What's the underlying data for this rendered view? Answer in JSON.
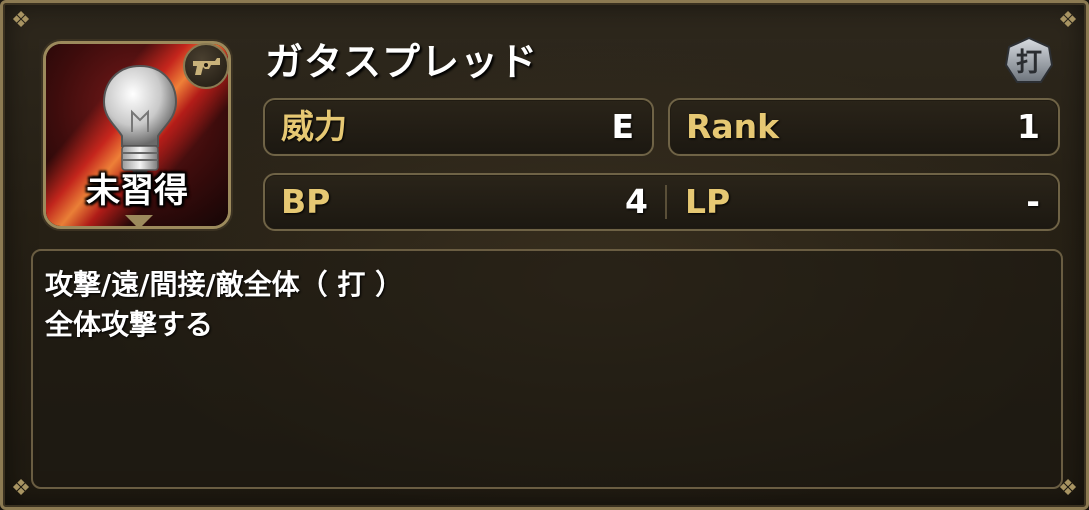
{
  "skill": {
    "name": "ガタスプレッド",
    "learn_status": "未習得",
    "type_badge": "打"
  },
  "stats": {
    "power_label": "威力",
    "power_value": "E",
    "rank_label": "Rank",
    "rank_value": "1",
    "bp_label": "BP",
    "bp_value": "4",
    "lp_label": "LP",
    "lp_value": "-"
  },
  "description": {
    "line1": "攻撃/遠/間接/敵全体（ 打 ）",
    "line2": "全体攻撃する"
  },
  "icons": {
    "skill_icon": "lightbulb-icon",
    "weapon_icon": "revolver-icon",
    "type_icon": "blunt-attack-icon"
  },
  "colors": {
    "label_gold": "#e6c873",
    "frame_gold": "#9c8a5c",
    "panel_bg": "#262015"
  }
}
